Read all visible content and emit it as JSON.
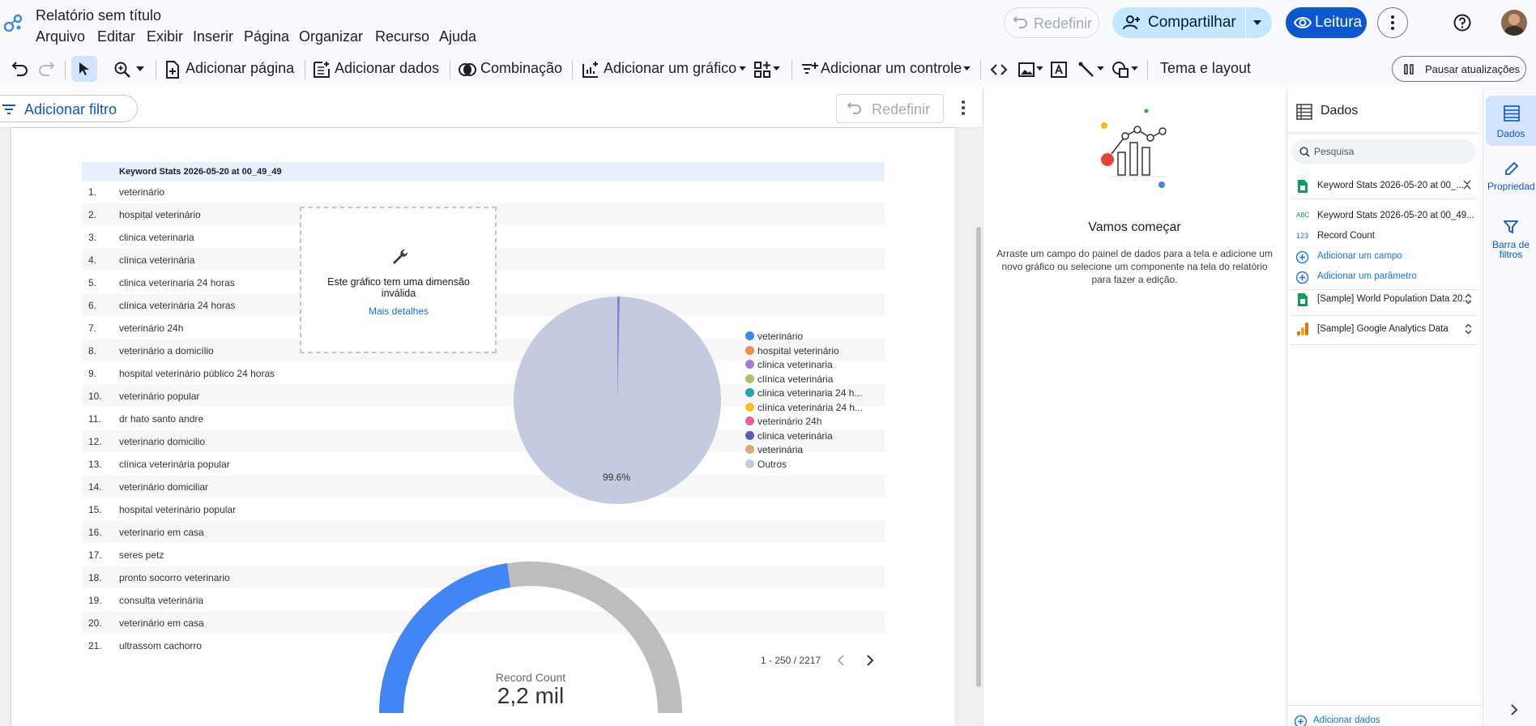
{
  "app": {
    "title": "Relatório sem título",
    "menu": [
      "Arquivo",
      "Editar",
      "Exibir",
      "Inserir",
      "Página",
      "Organizar",
      "Recurso",
      "Ajuda"
    ],
    "redo_label": "Redefinir",
    "share_label": "Compartilhar",
    "view_label": "Leitura"
  },
  "toolbar": {
    "add_page": "Adicionar página",
    "add_data": "Adicionar dados",
    "blend": "Combinação",
    "add_chart": "Adicionar um gráfico",
    "add_control": "Adicionar um controle",
    "theme": "Tema e layout",
    "pause": "Pausar atualizações"
  },
  "filterbar": {
    "add_filter": "Adicionar filtro",
    "reset": "Redefinir"
  },
  "table": {
    "header": "Keyword Stats 2026-05-20 at 00_49_49",
    "rows": [
      {
        "n": "1.",
        "kw": "veterinário"
      },
      {
        "n": "2.",
        "kw": "hospital veterinário"
      },
      {
        "n": "3.",
        "kw": "clinica veterinaria"
      },
      {
        "n": "4.",
        "kw": "clínica veterinária"
      },
      {
        "n": "5.",
        "kw": "clinica veterinaria 24 horas"
      },
      {
        "n": "6.",
        "kw": "clínica veterinária 24 horas"
      },
      {
        "n": "7.",
        "kw": "veterinário 24h"
      },
      {
        "n": "8.",
        "kw": "veterinário a domicílio"
      },
      {
        "n": "9.",
        "kw": "hospital veterinário público 24 horas"
      },
      {
        "n": "10.",
        "kw": "veterinário popular"
      },
      {
        "n": "11.",
        "kw": "dr hato santo andre"
      },
      {
        "n": "12.",
        "kw": "veterinario domicilio"
      },
      {
        "n": "13.",
        "kw": "clínica veterinária popular"
      },
      {
        "n": "14.",
        "kw": "veterinário domiciliar"
      },
      {
        "n": "15.",
        "kw": "hospital veterinário popular"
      },
      {
        "n": "16.",
        "kw": "veterinario em casa"
      },
      {
        "n": "17.",
        "kw": "seres petz"
      },
      {
        "n": "18.",
        "kw": "pronto socorro veterinario"
      },
      {
        "n": "19.",
        "kw": "consulta veterinária"
      },
      {
        "n": "20.",
        "kw": "veterinário em casa"
      },
      {
        "n": "21.",
        "kw": "ultrassom cachorro"
      }
    ],
    "pagination": "1 - 250 / 2217"
  },
  "invalid_chart": {
    "message": "Este gráfico tem uma dimensão inválida",
    "link": "Mais detalhes"
  },
  "pie": {
    "percent_label": "99.6%",
    "legend": [
      {
        "label": "veterinário",
        "color": "#4285f4"
      },
      {
        "label": "hospital veterinário",
        "color": "#f28b50"
      },
      {
        "label": "clinica veterinaria",
        "color": "#a77dd6"
      },
      {
        "label": "clínica veterinária",
        "color": "#a5c561"
      },
      {
        "label": "clinica veterinaria 24 h...",
        "color": "#21a6b6"
      },
      {
        "label": "clínica veterinária 24 h...",
        "color": "#f4c21d"
      },
      {
        "label": "veterinário 24h",
        "color": "#e4619f"
      },
      {
        "label": "clinica veterinária",
        "color": "#5b5bbf"
      },
      {
        "label": "veterinária",
        "color": "#d5ad7a"
      },
      {
        "label": "Outros",
        "color": "#c4cadf"
      }
    ]
  },
  "gauge": {
    "label": "Record Count",
    "value": "2,2 mil"
  },
  "getting_started": {
    "title": "Vamos começar",
    "body": "Arraste um campo do painel de dados para a tela e adicione um novo gráfico ou selecione um componente na tela do relatório para fazer a edição."
  },
  "data_panel": {
    "title": "Dados",
    "search_placeholder": "Pesquisa",
    "source1": "Keyword Stats 2026-05-20 at 00_...",
    "field1": "Keyword Stats 2026-05-20 at 00_49...",
    "field2": "Record Count",
    "add_field": "Adicionar um campo",
    "add_param": "Adicionar um parâmetro",
    "source2": "[Sample] World Population Data 20...",
    "source3": "[Sample] Google Analytics Data",
    "add_data": "Adicionar dados",
    "type_text": "ABC",
    "type_num": "123"
  },
  "rail": {
    "data": "Dados",
    "props": "Propriedad es",
    "filters": "Barra de filtros"
  },
  "colors": {
    "accent": "#0b57d0",
    "share_bg": "#c2e7ff",
    "gauge_fill": "#4285f4",
    "gauge_rest": "#bdbdbd"
  }
}
